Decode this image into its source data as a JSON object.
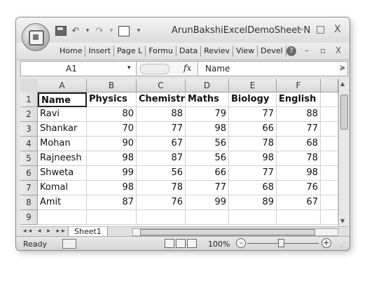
{
  "window": {
    "title": "ArunBakshiExcelDemoSheet  N",
    "controls": {
      "minimize": "–",
      "maximize": "□",
      "close": "X"
    }
  },
  "quick_access": {
    "undo": "↶",
    "undo_arrow": "▾",
    "redo": "↷",
    "redo_arrow": "▾",
    "customize": "▾"
  },
  "ribbon": {
    "tabs": [
      "Home",
      "Insert",
      "Page L",
      "Formu",
      "Data",
      "Reviev",
      "View",
      "Devel"
    ],
    "help": "?",
    "controls": {
      "minimize": "–",
      "restore": "▫",
      "close": "X"
    }
  },
  "formula_bar": {
    "name_box": "A1",
    "dropdown": "▾",
    "fx": "fx",
    "content": "Name",
    "expand": "≽"
  },
  "grid": {
    "columns": [
      "A",
      "B",
      "C",
      "D",
      "E",
      "F"
    ],
    "row_numbers": [
      "1",
      "2",
      "3",
      "4",
      "5",
      "6",
      "7",
      "8",
      "9"
    ],
    "header_row": [
      "Name",
      "Physics",
      "Chemistry",
      "Maths",
      "Biology",
      "English"
    ],
    "rows": [
      [
        "Ravi",
        "80",
        "88",
        "79",
        "77",
        "88"
      ],
      [
        "Shankar",
        "70",
        "77",
        "98",
        "66",
        "77"
      ],
      [
        "Mohan",
        "90",
        "67",
        "56",
        "78",
        "68"
      ],
      [
        "Rajneesh",
        "98",
        "87",
        "56",
        "98",
        "78"
      ],
      [
        "Shweta",
        "99",
        "56",
        "66",
        "77",
        "98"
      ],
      [
        "Komal",
        "98",
        "78",
        "77",
        "68",
        "76"
      ],
      [
        "Amit",
        "87",
        "76",
        "99",
        "89",
        "67"
      ]
    ]
  },
  "sheet_tabs": {
    "nav": "◂◂ ◂ ▸ ▸▸",
    "active": "Sheet1"
  },
  "status": {
    "ready": "Ready",
    "zoom": "100%",
    "zoom_minus": "–",
    "zoom_plus": "+"
  }
}
